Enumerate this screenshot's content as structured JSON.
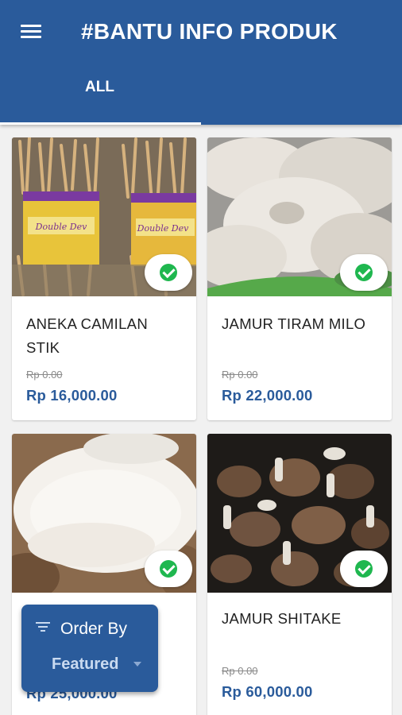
{
  "app": {
    "title": "#BANTU INFO PRODUK"
  },
  "tabs": [
    {
      "label": "ALL",
      "selected": true
    }
  ],
  "products": [
    {
      "name": "ANEKA CAMILAN STIK",
      "old_price": "Rp 0.00",
      "price": "Rp 16,000.00",
      "icon": "check-circle-icon"
    },
    {
      "name": "JAMUR TIRAM MILO",
      "old_price": "Rp 0.00",
      "price": "Rp 22,000.00",
      "icon": "check-circle-icon"
    },
    {
      "name": "",
      "old_price": "",
      "price": "Rp 25,000.00",
      "icon": "check-circle-icon"
    },
    {
      "name": "JAMUR SHITAKE",
      "old_price": "Rp 0.00",
      "price": "Rp 60,000.00",
      "icon": "check-circle-icon"
    }
  ],
  "order_by": {
    "label": "Order By",
    "value": "Featured",
    "icon": "filter-icon"
  },
  "colors": {
    "primary": "#2a5b9b",
    "price": "#2a5b9b",
    "check": "#1fb74f",
    "background": "#f1f1f1"
  }
}
